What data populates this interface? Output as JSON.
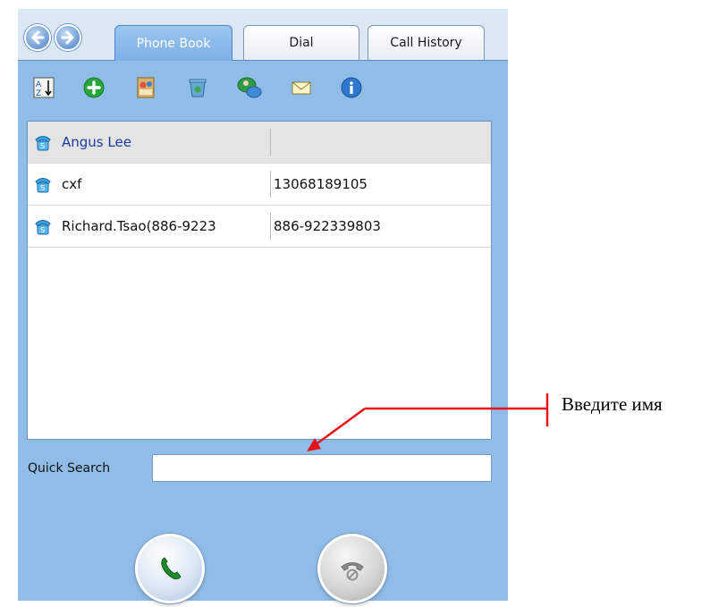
{
  "tabs": [
    {
      "label": "Phone Book",
      "active": true
    },
    {
      "label": "Dial",
      "active": false
    },
    {
      "label": "Call History",
      "active": false
    }
  ],
  "toolbar": {
    "icons": [
      "sort-az-icon",
      "add-contact-icon",
      "contacts-book-icon",
      "recycle-bin-icon",
      "chat-contact-icon",
      "email-icon",
      "info-icon"
    ]
  },
  "contacts": [
    {
      "name": "Angus Lee",
      "number": "",
      "selected": true
    },
    {
      "name": "cxf",
      "number": "13068189105",
      "selected": false
    },
    {
      "name": "Richard.Tsao(886-9223",
      "number": "886-922339803",
      "selected": false
    }
  ],
  "quick_search": {
    "label": "Quick Search",
    "value": "",
    "placeholder": ""
  },
  "annotation": {
    "text": "Введите имя",
    "color": "#e8101a"
  },
  "colors": {
    "panel": "#8fbde8",
    "active_tab": "#7cb0e6",
    "call_green": "#1f8a2e"
  }
}
